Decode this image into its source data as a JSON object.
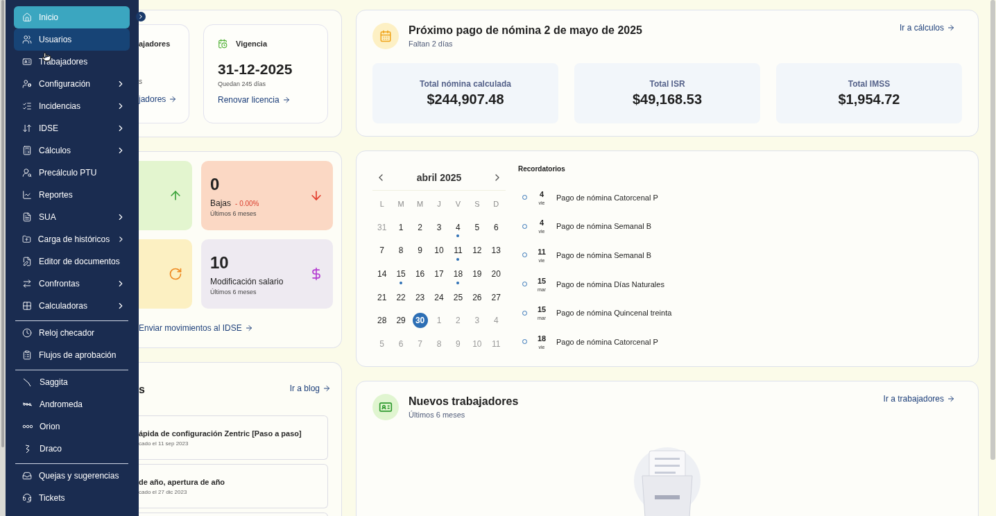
{
  "sidebar": {
    "groups": [
      {
        "items": [
          {
            "label": "Inicio",
            "selected": true,
            "hovered": false,
            "has_submenu": false
          },
          {
            "label": "Usuarios",
            "selected": false,
            "hovered": true,
            "has_submenu": false
          },
          {
            "label": "Trabajadores",
            "selected": false,
            "hovered": false,
            "has_submenu": false
          },
          {
            "label": "Configuración",
            "selected": false,
            "hovered": false,
            "has_submenu": true
          },
          {
            "label": "Incidencias",
            "selected": false,
            "hovered": false,
            "has_submenu": true
          },
          {
            "label": "IDSE",
            "selected": false,
            "hovered": false,
            "has_submenu": true
          },
          {
            "label": "Cálculos",
            "selected": false,
            "hovered": false,
            "has_submenu": true
          },
          {
            "label": "Precálculo PTU",
            "selected": false,
            "hovered": false,
            "has_submenu": false
          },
          {
            "label": "Reportes",
            "selected": false,
            "hovered": false,
            "has_submenu": false
          },
          {
            "label": "SUA",
            "selected": false,
            "hovered": false,
            "has_submenu": true
          },
          {
            "label": "Carga de históricos",
            "selected": false,
            "hovered": false,
            "has_submenu": true
          },
          {
            "label": "Editor de documentos",
            "selected": false,
            "hovered": false,
            "has_submenu": false
          },
          {
            "label": "Confrontas",
            "selected": false,
            "hovered": false,
            "has_submenu": true
          },
          {
            "label": "Calculadoras",
            "selected": false,
            "hovered": false,
            "has_submenu": true
          }
        ]
      },
      {
        "items": [
          {
            "label": "Reloj checador",
            "selected": false,
            "hovered": false,
            "has_submenu": false
          },
          {
            "label": "Flujos de aprobación",
            "selected": false,
            "hovered": false,
            "has_submenu": false
          }
        ]
      },
      {
        "items": [
          {
            "label": "Saggita",
            "selected": false,
            "hovered": false,
            "has_submenu": false
          },
          {
            "label": "Andromeda",
            "selected": false,
            "hovered": false,
            "has_submenu": false
          },
          {
            "label": "Orion",
            "selected": false,
            "hovered": false,
            "has_submenu": false
          },
          {
            "label": "Draco",
            "selected": false,
            "hovered": false,
            "has_submenu": false
          }
        ]
      },
      {
        "items": [
          {
            "label": "Quejas y sugerencias",
            "selected": false,
            "hovered": false,
            "has_submenu": false
          },
          {
            "label": "Tickets",
            "selected": false,
            "hovered": false,
            "has_submenu": false
          }
        ]
      }
    ]
  },
  "license": {
    "workers": {
      "title": "ajadores",
      "count": "s",
      "link": "jadores"
    },
    "validity": {
      "title": "Vigencia",
      "date": "31-12-2025",
      "note": "Quedan 245 días",
      "link": "Renovar licencia"
    }
  },
  "movements": {
    "tiles": [
      {
        "kind": "up"
      },
      {
        "kind": "down",
        "value": "0",
        "label": "Bajas",
        "change": "- 0.00%",
        "note": "Últimos 6 meses"
      },
      {
        "kind": "refresh"
      },
      {
        "kind": "salary",
        "value": "10",
        "label": "Modificación salario",
        "note": "Últimos 6 meses"
      }
    ],
    "link": "Enviar movimientos al IDSE"
  },
  "blog": {
    "title": "s",
    "link": "Ir a blog",
    "posts": [
      {
        "title": "ápida de configuración Zentric [Paso a paso]",
        "date": "cado el 11 sep 2023"
      },
      {
        "title": "de año, apertura de año",
        "date": "cado el 27 dic 2023"
      }
    ]
  },
  "payroll": {
    "title": "Próximo pago de nómina 2 de mayo de 2025",
    "subtitle": "Faltan 2 días",
    "link": "Ir a cálculos",
    "totals": [
      {
        "label": "Total nómina calculada",
        "value": "$244,907.48"
      },
      {
        "label": "Total ISR",
        "value": "$49,168.53"
      },
      {
        "label": "Total IMSS",
        "value": "$1,954.72"
      }
    ]
  },
  "calendar": {
    "month": "abril 2025",
    "weekdays": [
      "L",
      "M",
      "M",
      "J",
      "V",
      "S",
      "D"
    ],
    "weeks": [
      [
        {
          "d": "31",
          "outside": true,
          "event": false,
          "selected": false
        },
        {
          "d": "1",
          "outside": false,
          "event": false,
          "selected": false
        },
        {
          "d": "2",
          "outside": false,
          "event": false,
          "selected": false
        },
        {
          "d": "3",
          "outside": false,
          "event": false,
          "selected": false
        },
        {
          "d": "4",
          "outside": false,
          "event": true,
          "selected": false
        },
        {
          "d": "5",
          "outside": false,
          "event": false,
          "selected": false
        },
        {
          "d": "6",
          "outside": false,
          "event": false,
          "selected": false
        }
      ],
      [
        {
          "d": "7",
          "outside": false,
          "event": false,
          "selected": false
        },
        {
          "d": "8",
          "outside": false,
          "event": false,
          "selected": false
        },
        {
          "d": "9",
          "outside": false,
          "event": false,
          "selected": false
        },
        {
          "d": "10",
          "outside": false,
          "event": false,
          "selected": false
        },
        {
          "d": "11",
          "outside": false,
          "event": true,
          "selected": false
        },
        {
          "d": "12",
          "outside": false,
          "event": false,
          "selected": false
        },
        {
          "d": "13",
          "outside": false,
          "event": false,
          "selected": false
        }
      ],
      [
        {
          "d": "14",
          "outside": false,
          "event": false,
          "selected": false
        },
        {
          "d": "15",
          "outside": false,
          "event": true,
          "selected": false
        },
        {
          "d": "16",
          "outside": false,
          "event": false,
          "selected": false
        },
        {
          "d": "17",
          "outside": false,
          "event": false,
          "selected": false
        },
        {
          "d": "18",
          "outside": false,
          "event": true,
          "selected": false
        },
        {
          "d": "19",
          "outside": false,
          "event": false,
          "selected": false
        },
        {
          "d": "20",
          "outside": false,
          "event": false,
          "selected": false
        }
      ],
      [
        {
          "d": "21",
          "outside": false,
          "event": false,
          "selected": false
        },
        {
          "d": "22",
          "outside": false,
          "event": false,
          "selected": false
        },
        {
          "d": "23",
          "outside": false,
          "event": false,
          "selected": false
        },
        {
          "d": "24",
          "outside": false,
          "event": false,
          "selected": false
        },
        {
          "d": "25",
          "outside": false,
          "event": false,
          "selected": false
        },
        {
          "d": "26",
          "outside": false,
          "event": false,
          "selected": false
        },
        {
          "d": "27",
          "outside": false,
          "event": false,
          "selected": false
        }
      ],
      [
        {
          "d": "28",
          "outside": false,
          "event": false,
          "selected": false
        },
        {
          "d": "29",
          "outside": false,
          "event": false,
          "selected": false
        },
        {
          "d": "30",
          "outside": false,
          "event": false,
          "selected": true
        },
        {
          "d": "1",
          "outside": true,
          "event": false,
          "selected": false
        },
        {
          "d": "2",
          "outside": true,
          "event": false,
          "selected": false
        },
        {
          "d": "3",
          "outside": true,
          "event": false,
          "selected": false
        },
        {
          "d": "4",
          "outside": true,
          "event": false,
          "selected": false
        }
      ],
      [
        {
          "d": "5",
          "outside": true,
          "event": false,
          "selected": false
        },
        {
          "d": "6",
          "outside": true,
          "event": false,
          "selected": false
        },
        {
          "d": "7",
          "outside": true,
          "event": false,
          "selected": false
        },
        {
          "d": "8",
          "outside": true,
          "event": false,
          "selected": false
        },
        {
          "d": "9",
          "outside": true,
          "event": false,
          "selected": false
        },
        {
          "d": "10",
          "outside": true,
          "event": false,
          "selected": false
        },
        {
          "d": "11",
          "outside": true,
          "event": false,
          "selected": false
        }
      ]
    ]
  },
  "reminders": {
    "title": "Recordatorios",
    "items": [
      {
        "day": "4",
        "weekday": "vie",
        "text": "Pago de nómina Catorcenal P"
      },
      {
        "day": "4",
        "weekday": "vie",
        "text": "Pago de nómina Semanal B"
      },
      {
        "day": "11",
        "weekday": "vie",
        "text": "Pago de nómina Semanal B"
      },
      {
        "day": "15",
        "weekday": "mar",
        "text": "Pago de nómina Días Naturales"
      },
      {
        "day": "15",
        "weekday": "mar",
        "text": "Pago de nómina Quincenal treinta"
      },
      {
        "day": "18",
        "weekday": "vie",
        "text": "Pago de nómina Catorcenal P"
      }
    ]
  },
  "new_workers": {
    "title": "Nuevos trabajadores",
    "subtitle": "Últimos 6 meses",
    "link": "Ir a trabajadores"
  }
}
